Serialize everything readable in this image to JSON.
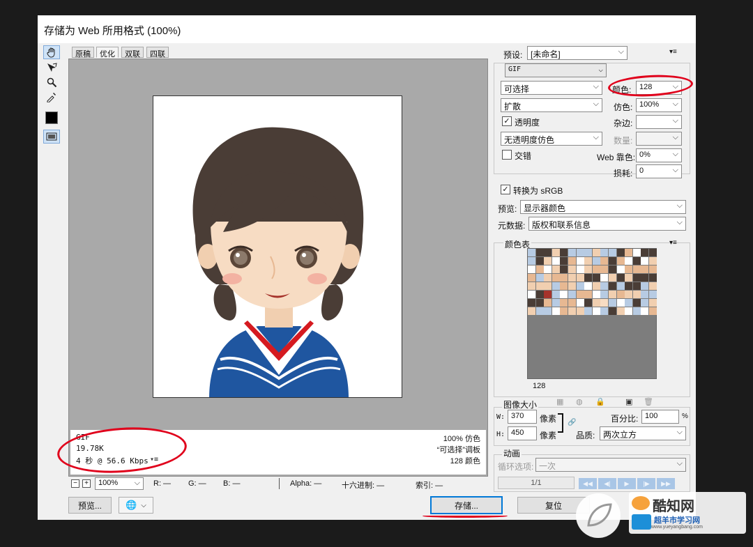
{
  "title": "存储为 Web 所用格式 (100%)",
  "tabs": [
    "原稿",
    "优化",
    "双联",
    "四联"
  ],
  "info": {
    "format": "GIF",
    "size": "19.78K",
    "time": "4 秒 @ 56.6 Kbps",
    "dither": "100% 仿色",
    "palette": "“可选择”调板",
    "colors": "128 颜色"
  },
  "bottombar": {
    "zoom": "100%",
    "r": "R: —",
    "g": "G: —",
    "b": "B: —",
    "alpha": "Alpha: —",
    "hex": "十六进制: —",
    "index": "索引: —"
  },
  "buttons": {
    "preview": "预览...",
    "save": "存储...",
    "reset": "复位"
  },
  "settings": {
    "preset_label": "预设:",
    "preset_value": "[未命名]",
    "format": "GIF",
    "reduction": "可选择",
    "colors_label": "颜色:",
    "colors_value": "128",
    "dither_algo": "扩散",
    "dither_label": "仿色:",
    "dither_value": "100%",
    "transparency_label": "透明度",
    "matte_label": "杂边:",
    "trans_dither": "无透明度仿色",
    "amount_label": "数量:",
    "interlaced_label": "交错",
    "websnap_label": "Web 靠色:",
    "websnap_value": "0%",
    "lossy_label": "损耗:",
    "lossy_value": "0",
    "srgb_label": "转换为 sRGB",
    "preview_label": "预览:",
    "preview_value": "显示器颜色",
    "metadata_label": "元数据:",
    "metadata_value": "版权和联系信息"
  },
  "color_table": {
    "label": "颜色表",
    "count": "128"
  },
  "image_size": {
    "label": "图像大小",
    "w_label": "W:",
    "w_value": "370",
    "h_label": "H:",
    "h_value": "450",
    "unit": "像素",
    "percent_label": "百分比:",
    "percent_value": "100",
    "percent_unit": "%",
    "quality_label": "品质:",
    "quality_value": "两次立方"
  },
  "animation": {
    "label": "动画",
    "loop_label": "循环选项:",
    "loop_value": "一次",
    "frame": "1/1"
  },
  "watermark": {
    "brand": "酷知网",
    "site": "超羊市学习网",
    "url": "www.yueyangbang.com"
  },
  "colors": {
    "hair": "#4a3d36",
    "skin": "#f7dcc3",
    "blush": "#f3b2a2",
    "uniform": "#1f56a0",
    "collar_red": "#d51a20",
    "annotation": "#e0001b",
    "focus": "#0078d7"
  }
}
